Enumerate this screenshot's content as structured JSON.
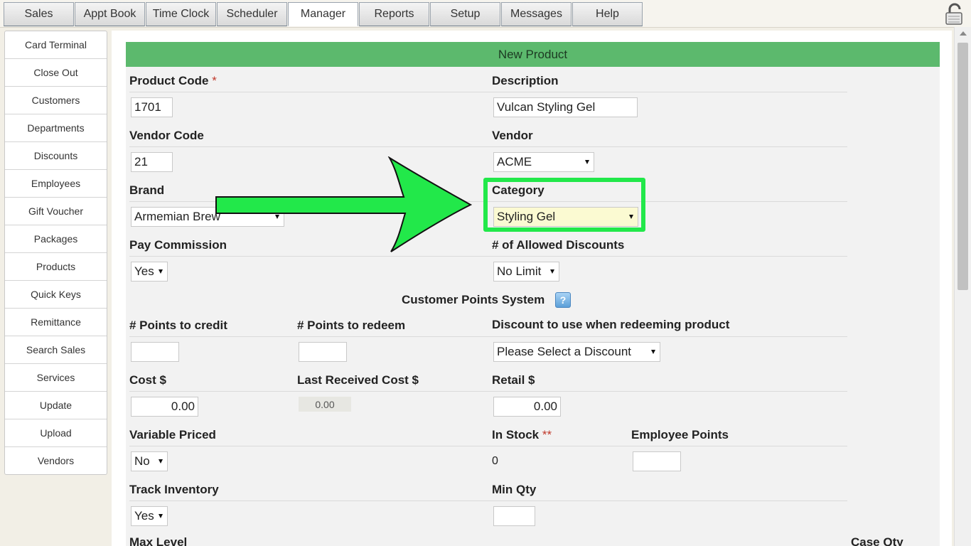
{
  "tabs": [
    "Sales",
    "Appt Book",
    "Time Clock",
    "Scheduler",
    "Manager",
    "Reports",
    "Setup",
    "Messages",
    "Help"
  ],
  "sidebar": [
    "Card Terminal",
    "Close Out",
    "Customers",
    "Departments",
    "Discounts",
    "Employees",
    "Gift Voucher",
    "Packages",
    "Products",
    "Quick Keys",
    "Remittance",
    "Search Sales",
    "Services",
    "Update",
    "Upload",
    "Vendors"
  ],
  "form": {
    "title": "New Product",
    "product_code_label": "Product Code",
    "required_mark": "*",
    "product_code": "1701",
    "description_label": "Description",
    "description": "Vulcan Styling Gel",
    "vendor_code_label": "Vendor Code",
    "vendor_code": "21",
    "vendor_label": "Vendor",
    "vendor": "ACME",
    "brand_label": "Brand",
    "brand": "Armemian Brew",
    "category_label": "Category",
    "category": "Styling Gel",
    "pay_commission_label": "Pay Commission",
    "pay_commission": "Yes",
    "allowed_discounts_label": "# of Allowed Discounts",
    "allowed_discounts": "No Limit",
    "points_system_label": "Customer Points System",
    "help_glyph": "?",
    "points_credit_label": "# Points to credit",
    "points_credit": "",
    "points_redeem_label": "# Points to redeem",
    "points_redeem": "",
    "discount_redeem_label": "Discount to use when redeeming product",
    "discount_redeem": "Please Select a Discount",
    "cost_label": "Cost $",
    "cost": "0.00",
    "last_received_label": "Last Received Cost $",
    "last_received": "0.00",
    "retail_label": "Retail $",
    "retail": "0.00",
    "variable_priced_label": "Variable Priced",
    "variable_priced": "No",
    "in_stock_label": "In Stock",
    "in_stock_mark": "**",
    "in_stock": "0",
    "employee_points_label": "Employee Points",
    "employee_points": "",
    "track_inventory_label": "Track Inventory",
    "track_inventory": "Yes",
    "min_qty_label": "Min Qty",
    "min_qty": "",
    "max_level_label": "Max Level",
    "case_qty_label": "Case Qty"
  },
  "colors": {
    "header_green": "#5cb96d",
    "annotation_green": "#22e84a",
    "highlight_field": "#fbfad2"
  }
}
